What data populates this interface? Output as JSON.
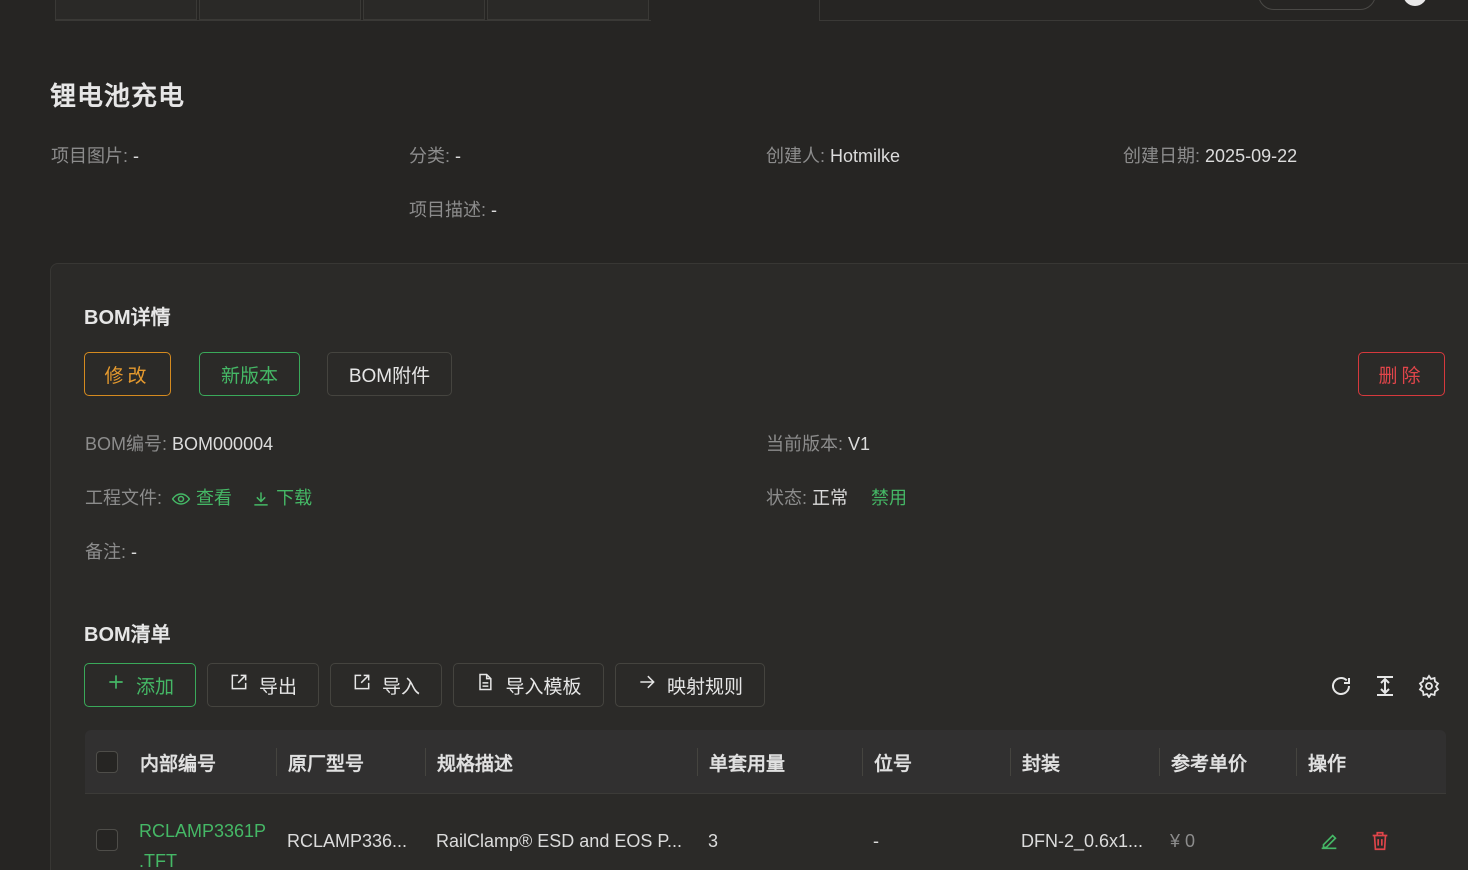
{
  "project": {
    "title": "锂电池充电",
    "fields": [
      {
        "label": "项目图片:",
        "value": "-"
      },
      {
        "label": "分类:",
        "value": "-"
      },
      {
        "label": "创建人:",
        "value": "Hotmilke"
      },
      {
        "label": "创建日期:",
        "value": "2025-09-22"
      },
      {
        "label": "项目描述:",
        "value": "-"
      }
    ]
  },
  "bom_details": {
    "title": "BOM详情",
    "buttons": {
      "edit": "修改",
      "new_version": "新版本",
      "attachments": "BOM附件",
      "delete": "删除"
    },
    "bom_no_label": "BOM编号:",
    "bom_no_value": "BOM000004",
    "version_label": "当前版本:",
    "version_value": "V1",
    "eng_file_label": "工程文件:",
    "view_link": "查看",
    "download_link": "下载",
    "status_label": "状态:",
    "status_value": "正常",
    "disable_link": "禁用",
    "remark_label": "备注:",
    "remark_value": "-"
  },
  "bom_list": {
    "title": "BOM清单",
    "toolbar": {
      "add": "添加",
      "export": "导出",
      "import": "导入",
      "import_template": "导入模板",
      "mapping_rules": "映射规则"
    },
    "columns": [
      "内部编号",
      "原厂型号",
      "规格描述",
      "单套用量",
      "位号",
      "封装",
      "参考单价",
      "操作"
    ],
    "rows": [
      {
        "internal_no_line1": "RCLAMP3361P",
        "internal_no_line2": ".TFT",
        "mfr_part": "RCLAMP336...",
        "spec": "RailClamp® ESD and EOS P...",
        "qty": "3",
        "designator": "-",
        "package": "DFN-2_0.6x1...",
        "price": "¥ 0"
      }
    ]
  },
  "colors": {
    "accent_green": "#45b866",
    "warning_orange": "#e69a2e",
    "danger_red": "#e0454a"
  }
}
